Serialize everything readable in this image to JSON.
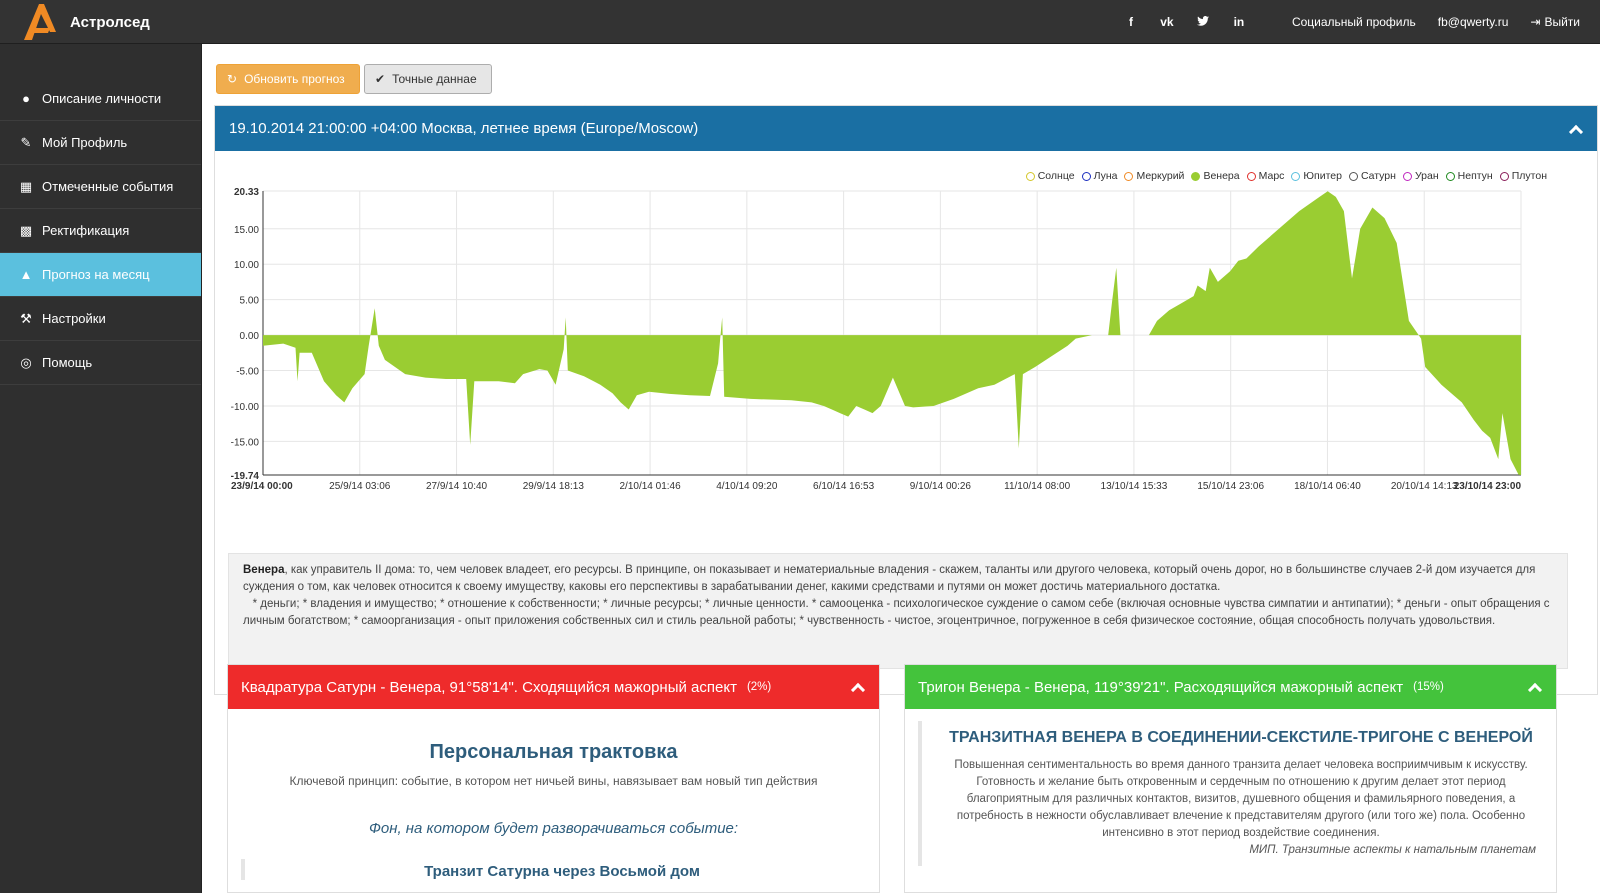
{
  "topbar": {
    "brand": "Астролсед",
    "social": [
      "f",
      "vk",
      "t",
      "in"
    ],
    "links": [
      "Социальный профиль",
      "fb@qwerty.ru",
      "Выйти"
    ]
  },
  "sidebar": {
    "items": [
      {
        "label": "Описание личности",
        "icon": "user-icon"
      },
      {
        "label": "Мой Профиль",
        "icon": "edit-icon"
      },
      {
        "label": "Отмеченные события",
        "icon": "calendar-icon"
      },
      {
        "label": "Ректификация",
        "icon": "industry-icon"
      },
      {
        "label": "Прогноз на месяц",
        "icon": "area-chart-icon",
        "active": true
      },
      {
        "label": "Настройки",
        "icon": "wrench-icon"
      },
      {
        "label": "Помощь",
        "icon": "life-ring-icon"
      }
    ]
  },
  "toolbar": {
    "refresh_label": "Обновить прогноз",
    "exact_label": "Точные даннае"
  },
  "panel": {
    "title": "19.10.2014 21:00:00 +04:00 Москва, летнее время (Europe/Moscow)"
  },
  "chart_data": {
    "type": "area",
    "legend": [
      {
        "name": "Солнце",
        "color": "#d4c72a",
        "filled": false
      },
      {
        "name": "Луна",
        "color": "#1c2fbf",
        "filled": false
      },
      {
        "name": "Меркурий",
        "color": "#f08a24",
        "filled": false
      },
      {
        "name": "Венера",
        "color": "#9acd32",
        "filled": true
      },
      {
        "name": "Марс",
        "color": "#e0302b",
        "filled": false
      },
      {
        "name": "Юпитер",
        "color": "#5bc0de",
        "filled": false
      },
      {
        "name": "Сатурн",
        "color": "#555555",
        "filled": false
      },
      {
        "name": "Уран",
        "color": "#c027c0",
        "filled": false
      },
      {
        "name": "Нептун",
        "color": "#1f8a1f",
        "filled": false
      },
      {
        "name": "Плутон",
        "color": "#8a1f5a",
        "filled": false
      }
    ],
    "legend_position": "top-right",
    "ylim": [
      -19.74,
      20.33
    ],
    "y_ticks": [
      "20.33",
      "15.00",
      "10.00",
      "5.00",
      "0.00",
      "-5.00",
      "-10.00",
      "-15.00",
      "-19.74"
    ],
    "x_ticks": [
      "23/9/14 00:00",
      "25/9/14 03:06",
      "27/9/14 10:40",
      "29/9/14 18:13",
      "2/10/14 01:46",
      "4/10/14 09:20",
      "6/10/14 16:53",
      "9/10/14 00:26",
      "11/10/14 08:00",
      "13/10/14 15:33",
      "15/10/14 23:06",
      "18/10/14 06:40",
      "20/10/14 14:13",
      "23/10/14 23:00"
    ],
    "x_range_days": [
      0,
      30.958
    ],
    "grid": true,
    "series": [
      {
        "name": "Венера",
        "color": "#9acd32",
        "points": [
          [
            0.0,
            -1.5
          ],
          [
            0.5,
            -1.2
          ],
          [
            0.8,
            -1.8
          ],
          [
            0.85,
            -6.5
          ],
          [
            0.9,
            -2.5
          ],
          [
            1.2,
            -2.5
          ],
          [
            1.5,
            -6.5
          ],
          [
            1.8,
            -8.5
          ],
          [
            2.0,
            -9.5
          ],
          [
            2.2,
            -7.5
          ],
          [
            2.5,
            -5.5
          ],
          [
            2.6,
            -1.5
          ],
          [
            2.75,
            3.8
          ],
          [
            2.85,
            -1.5
          ],
          [
            3.0,
            -3.5
          ],
          [
            3.5,
            -5.5
          ],
          [
            4.0,
            -6.0
          ],
          [
            4.5,
            -6.2
          ],
          [
            5.0,
            -6.2
          ],
          [
            5.1,
            -15.5
          ],
          [
            5.2,
            -6.5
          ],
          [
            5.8,
            -6.5
          ],
          [
            6.2,
            -6.8
          ],
          [
            6.4,
            -5.5
          ],
          [
            6.8,
            -4.8
          ],
          [
            7.0,
            -5.0
          ],
          [
            7.2,
            -7.0
          ],
          [
            7.4,
            -2.0
          ],
          [
            7.45,
            2.5
          ],
          [
            7.5,
            -5.0
          ],
          [
            7.9,
            -5.8
          ],
          [
            8.3,
            -7.0
          ],
          [
            8.6,
            -8.2
          ],
          [
            8.8,
            -9.5
          ],
          [
            9.0,
            -10.5
          ],
          [
            9.2,
            -8.5
          ],
          [
            9.5,
            -8.0
          ],
          [
            10.0,
            -8.3
          ],
          [
            10.5,
            -8.5
          ],
          [
            11.0,
            -8.6
          ],
          [
            11.2,
            -4.0
          ],
          [
            11.25,
            -0.5
          ],
          [
            11.3,
            2.5
          ],
          [
            11.35,
            -8.7
          ],
          [
            12.0,
            -9.0
          ],
          [
            13.0,
            -9.2
          ],
          [
            13.5,
            -9.5
          ],
          [
            13.8,
            -10.0
          ],
          [
            14.0,
            -10.5
          ],
          [
            14.2,
            -11.0
          ],
          [
            14.4,
            -11.5
          ],
          [
            14.6,
            -10.0
          ],
          [
            14.8,
            -10.5
          ],
          [
            15.0,
            -11.0
          ],
          [
            15.2,
            -10.0
          ],
          [
            15.5,
            -6.0
          ],
          [
            15.8,
            -10.0
          ],
          [
            16.0,
            -10.2
          ],
          [
            16.5,
            -10.0
          ],
          [
            17.0,
            -9.0
          ],
          [
            17.6,
            -7.5
          ],
          [
            18.0,
            -7.0
          ],
          [
            18.5,
            -5.5
          ],
          [
            18.6,
            -16.0
          ],
          [
            18.7,
            -5.5
          ],
          [
            19.0,
            -4.5
          ],
          [
            19.4,
            -3.0
          ],
          [
            19.8,
            -1.5
          ],
          [
            20.0,
            -0.5
          ],
          [
            20.4,
            0.0
          ],
          [
            20.8,
            0.0
          ],
          [
            20.9,
            5.0
          ],
          [
            21.0,
            9.5
          ],
          [
            21.1,
            0.0
          ],
          [
            21.8,
            0.0
          ],
          [
            22.0,
            2.0
          ],
          [
            22.3,
            3.5
          ],
          [
            22.6,
            4.5
          ],
          [
            22.9,
            5.5
          ],
          [
            23.0,
            7.0
          ],
          [
            23.2,
            6.2
          ],
          [
            23.3,
            9.5
          ],
          [
            23.5,
            7.5
          ],
          [
            23.8,
            9.0
          ],
          [
            24.0,
            10.5
          ],
          [
            24.2,
            10.8
          ],
          [
            24.5,
            12.5
          ],
          [
            25.0,
            15.0
          ],
          [
            25.5,
            17.5
          ],
          [
            26.0,
            19.5
          ],
          [
            26.2,
            20.3
          ],
          [
            26.4,
            19.5
          ],
          [
            26.6,
            17.5
          ],
          [
            26.8,
            8.0
          ],
          [
            27.0,
            15.0
          ],
          [
            27.3,
            18.0
          ],
          [
            27.6,
            16.5
          ],
          [
            27.9,
            13.0
          ],
          [
            28.2,
            2.0
          ],
          [
            28.5,
            -0.5
          ],
          [
            28.6,
            -4.5
          ],
          [
            29.0,
            -7.0
          ],
          [
            29.5,
            -9.5
          ],
          [
            29.8,
            -12.0
          ],
          [
            30.0,
            -13.5
          ],
          [
            30.2,
            -14.5
          ],
          [
            30.4,
            -17.5
          ],
          [
            30.5,
            -11.0
          ],
          [
            30.7,
            -17.5
          ],
          [
            30.9,
            -19.7
          ],
          [
            30.958,
            -19.74
          ]
        ]
      }
    ]
  },
  "description": {
    "title": "Венера",
    "line1": ", как управитель II дома: то, чем человек владеет, его ресурсы. В принципе, он показывает и нематериальные владения - скажем, таланты или другого человека, который очень дорог, но в большинстве случаев 2-й дом изучается для суждения о том, как человек относится к своему имуществу, каковы его перспективы в зарабатывании денег, какими средствами и путями он может достичь материального достатка.",
    "line2": "* деньги; * владения и имущество; * отношение к собственности; * личные ресурсы; * личные ценности. * самооценка - психологическое суждение о самом себе (включая основные чувства симпатии и антипатии); * деньги - опыт обращения с личным богатством; * самоорганизация - опыт приложения собственных сил и стиль реальной работы; * чувственность - чистое, эгоцентричное, погруженное в себя физическое состояние, общая способность получать удовольствия."
  },
  "aspects": [
    {
      "title": "Квадратура Сатурн - Венера, 91°58'14\". Сходящийся мажорный аспект",
      "percent": "(2%)",
      "color": "#ee2b2b",
      "heading": "Персональная трактовка",
      "principle": "Ключевой принцип: событие, в котором нет ничьей вины, навязывает вам новый тип действия",
      "background": "Фон, на котором будет разворачиваться событие:",
      "transit": "Транзит Сатурна через Восьмой дом"
    },
    {
      "title": "Тригон Венера - Венера, 119°39'21\". Расходящийся мажорный аспект",
      "percent": "(15%)",
      "color": "#44c33c",
      "heading": "ТРАНЗИТНАЯ ВЕНЕРА В СОЕДИНЕНИИ-СЕКСТИЛЕ-ТРИГОНЕ С ВЕНЕРОЙ",
      "text": "Повышенная сентиментальность во время данного транзита делает человека восприимчивым к искусству. Готовность и желание быть откровенным и сердечным по отношению к другим делает этот период благоприятным для различных контактов, визитов, душевного общения и фамильярного поведения, а потребность в нежности обуславливает влечение к представителям другого (или того же) пола. Особенно интенсивно в этот период воздействие соединения.",
      "source": "МИП. Транзитные аспекты к натальным планетам"
    }
  ]
}
